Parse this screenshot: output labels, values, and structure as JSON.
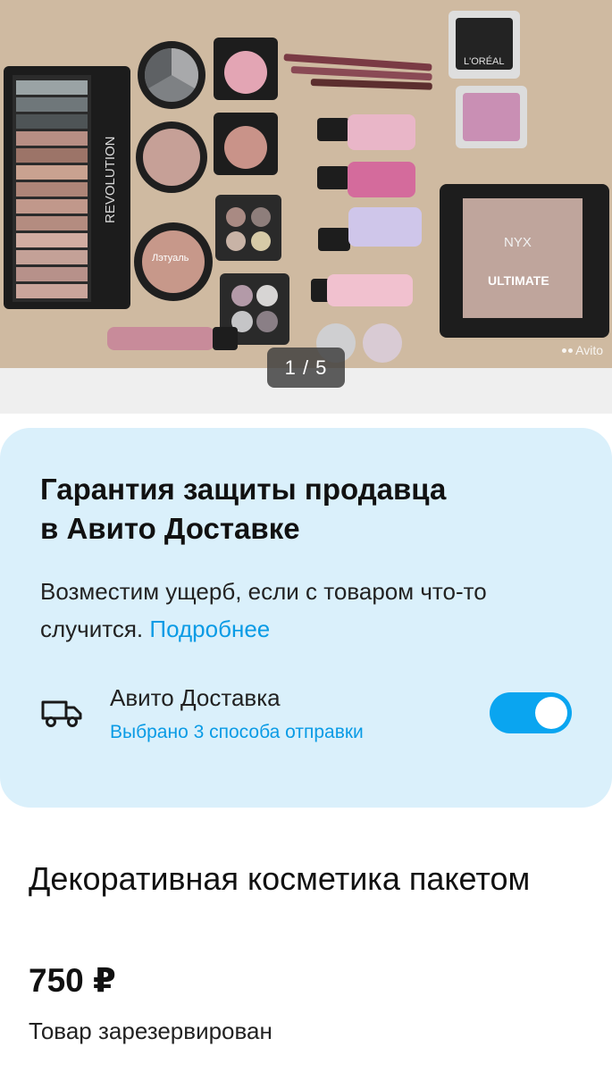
{
  "gallery": {
    "counter": "1 / 5",
    "watermark": "Avito",
    "photo_label": "REVOLUTION",
    "photo_brand_small": "Лэтуаль",
    "photo_brand_loreal": "L'ORÉAL",
    "photo_brand_nyx": "NYX",
    "photo_palette_name": "ULTIMATE",
    "colors": {
      "background": "#c9b39a",
      "pink": "#e9a9bd",
      "palette_black": "#1d1d1d"
    }
  },
  "promo": {
    "title_line1": "Гарантия защиты продавца",
    "title_line2": "в Авито Доставке",
    "text": "Возместим ущерб, если с товаром что-то случится.",
    "link": "Подробнее",
    "delivery_title": "Авито Доставка",
    "delivery_subtitle": "Выбрано 3 способа отправки",
    "toggle_on": true,
    "icon": "truck-icon",
    "colors": {
      "card_bg": "#daf0fb",
      "accent": "#0a9be5",
      "toggle": "#0aa5f0"
    }
  },
  "item": {
    "title": "Декоративная косметика пакетом",
    "price": "750 ₽",
    "status": "Товар зарезервирован"
  }
}
